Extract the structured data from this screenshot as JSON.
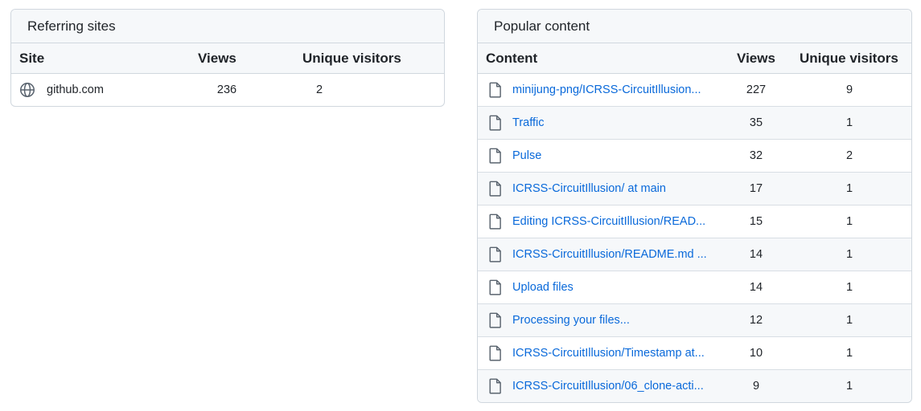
{
  "referring": {
    "title": "Referring sites",
    "headers": {
      "site": "Site",
      "views": "Views",
      "unique": "Unique visitors"
    },
    "rows": [
      {
        "site": "github.com",
        "views": "236",
        "unique": "2",
        "icon": "globe-icon"
      }
    ]
  },
  "popular": {
    "title": "Popular content",
    "headers": {
      "content": "Content",
      "views": "Views",
      "unique": "Unique visitors"
    },
    "rows": [
      {
        "content": "minijung-png/ICRSS-CircuitIllusion...",
        "views": "227",
        "unique": "9"
      },
      {
        "content": "Traffic",
        "views": "35",
        "unique": "1"
      },
      {
        "content": "Pulse",
        "views": "32",
        "unique": "2"
      },
      {
        "content": "ICRSS-CircuitIllusion/ at main",
        "views": "17",
        "unique": "1"
      },
      {
        "content": "Editing ICRSS-CircuitIllusion/READ...",
        "views": "15",
        "unique": "1"
      },
      {
        "content": "ICRSS-CircuitIllusion/README.md ...",
        "views": "14",
        "unique": "1"
      },
      {
        "content": "Upload files",
        "views": "14",
        "unique": "1"
      },
      {
        "content": "Processing your files...",
        "views": "12",
        "unique": "1"
      },
      {
        "content": "ICRSS-CircuitIllusion/Timestamp at...",
        "views": "10",
        "unique": "1"
      },
      {
        "content": "ICRSS-CircuitIllusion/06_clone-acti...",
        "views": "9",
        "unique": "1"
      }
    ]
  },
  "colors": {
    "link": "#0969da",
    "border": "#d0d7de",
    "header_bg": "#f6f8fa",
    "text": "#1f2328"
  }
}
